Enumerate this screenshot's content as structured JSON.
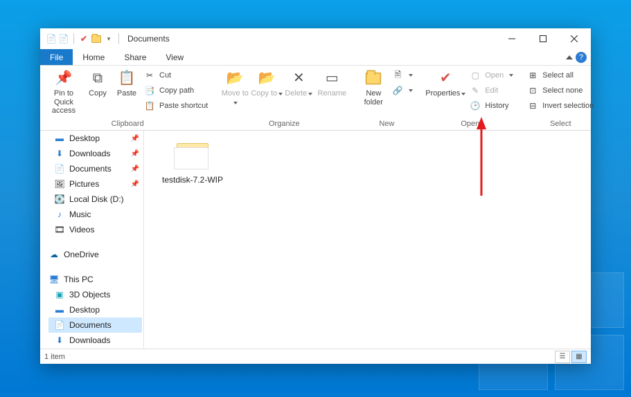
{
  "window": {
    "title": "Documents"
  },
  "tabs": {
    "file": "File",
    "home": "Home",
    "share": "Share",
    "view": "View"
  },
  "ribbon": {
    "clipboard": {
      "label": "Clipboard",
      "pin": "Pin to Quick access",
      "copy": "Copy",
      "paste": "Paste",
      "cut": "Cut",
      "copy_path": "Copy path",
      "paste_shortcut": "Paste shortcut"
    },
    "organize": {
      "label": "Organize",
      "move_to": "Move to",
      "copy_to": "Copy to",
      "delete": "Delete",
      "rename": "Rename"
    },
    "new": {
      "label": "New",
      "new_folder": "New folder",
      "new_item": "New item",
      "easy_access": "Easy access"
    },
    "open": {
      "label": "Open",
      "properties": "Properties",
      "open": "Open",
      "edit": "Edit",
      "history": "History"
    },
    "select": {
      "label": "Select",
      "select_all": "Select all",
      "select_none": "Select none",
      "invert": "Invert selection"
    }
  },
  "nav": {
    "desktop": "Desktop",
    "downloads": "Downloads",
    "documents": "Documents",
    "pictures": "Pictures",
    "local_disk": "Local Disk (D:)",
    "music": "Music",
    "videos": "Videos",
    "onedrive": "OneDrive",
    "this_pc": "This PC",
    "objects3d": "3D Objects",
    "pc_desktop": "Desktop",
    "pc_documents": "Documents",
    "pc_downloads": "Downloads"
  },
  "files": {
    "items": [
      {
        "name": "testdisk-7.2-WIP"
      }
    ]
  },
  "status": {
    "text": "1 item"
  }
}
